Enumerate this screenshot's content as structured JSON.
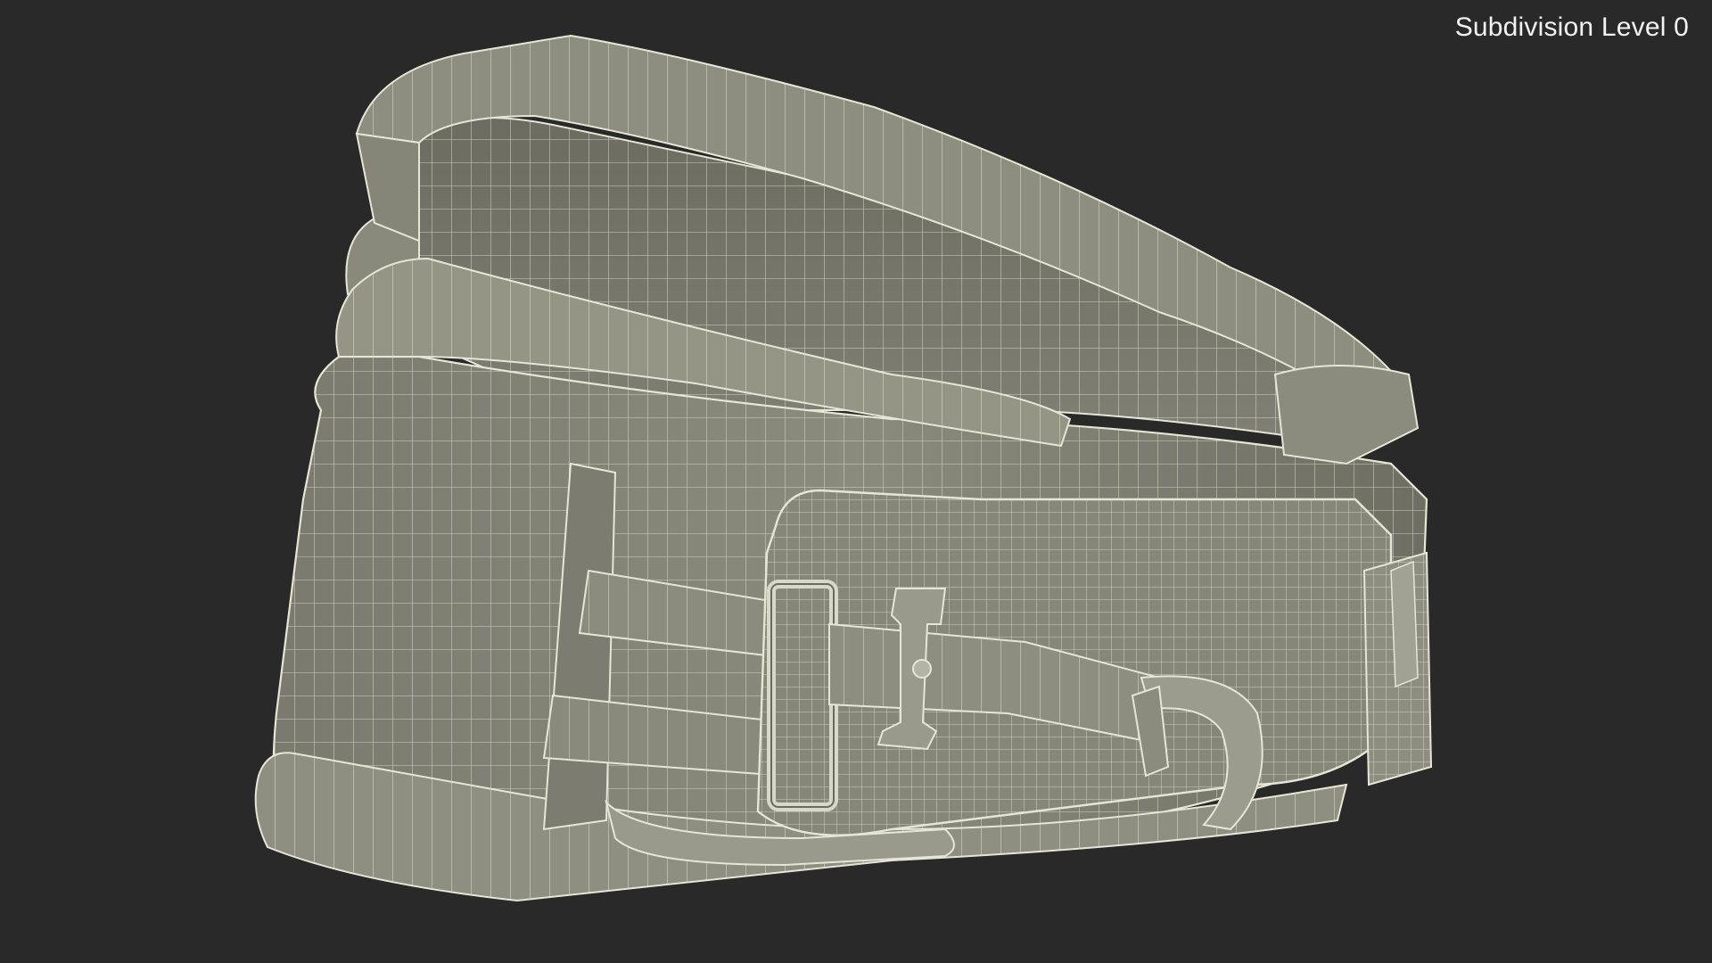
{
  "viewport": {
    "background": "#292929",
    "label": "Subdivision Level 0"
  },
  "model": {
    "subject": "wireframe-3d-model",
    "surface_color": "#8a8a7c",
    "wire_color": "#e6e6d6"
  }
}
